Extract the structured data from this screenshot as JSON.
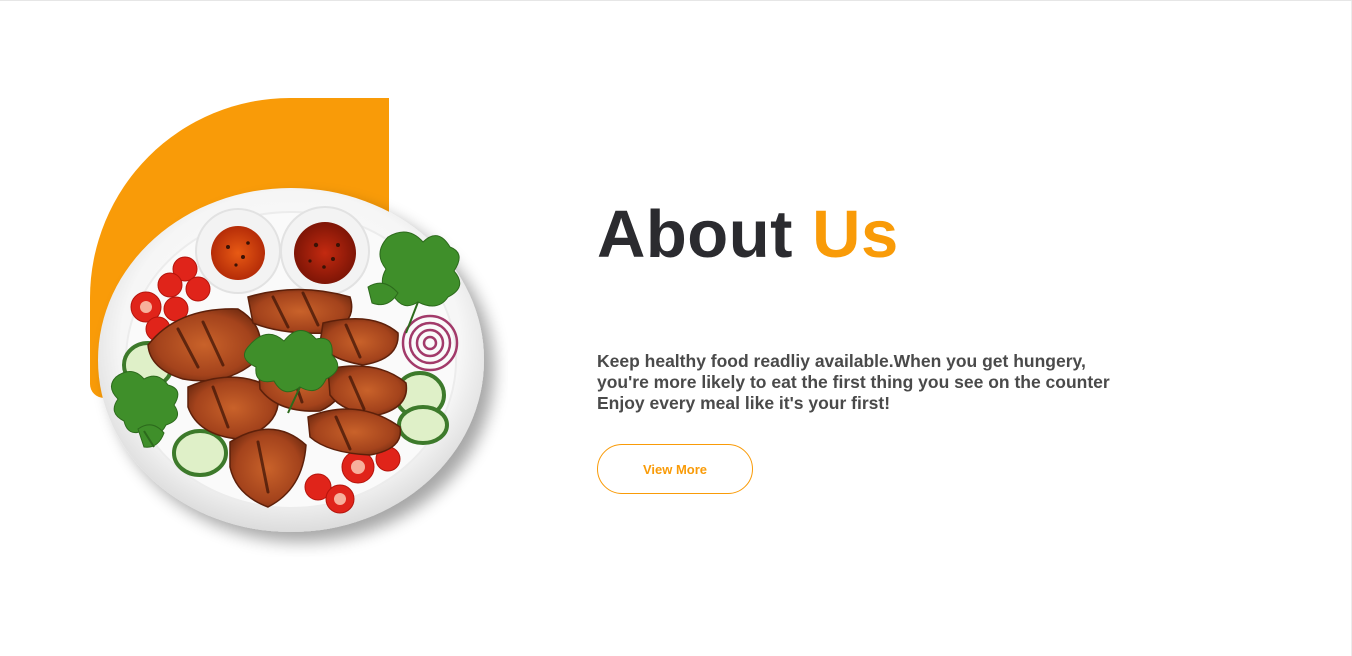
{
  "about": {
    "heading_main": "About",
    "heading_accent": "Us",
    "description_lines": [
      "Keep healthy food readliy available.When you get hungery,",
      "you're more likely to eat the first thing you see on the counter",
      "Enjoy every meal like it's your first!"
    ],
    "button_label": "View More"
  },
  "colors": {
    "accent": "#f99b08",
    "heading": "#2b2b2f",
    "body_text": "#4a4a4a"
  },
  "image": {
    "subject": "plate of grilled chicken with dipping sauces, tomatoes, cucumber, onion and parsley"
  }
}
